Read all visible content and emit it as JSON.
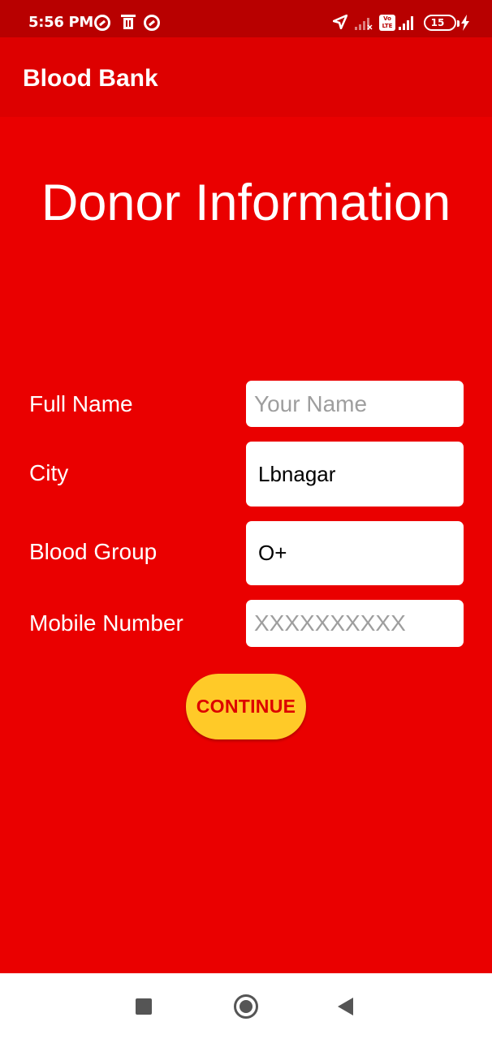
{
  "status_bar": {
    "time": "5:56 PM",
    "left_icons": [
      "sync-icon",
      "trash-icon",
      "sync-icon"
    ],
    "right_icons": [
      "navigation-icon",
      "signal-weak-icon",
      "volte-icon",
      "signal-icon",
      "battery-icon",
      "charging-icon"
    ],
    "volte_label": "Vo LTE",
    "battery_level": "15"
  },
  "app_bar": {
    "title": "Blood Bank"
  },
  "page": {
    "title": "Donor Information"
  },
  "form": {
    "full_name": {
      "label": "Full Name",
      "value": "",
      "placeholder": "Your Name"
    },
    "city": {
      "label": "City",
      "value": "Lbnagar",
      "placeholder": ""
    },
    "blood_group": {
      "label": "Blood Group",
      "value": "O+",
      "placeholder": ""
    },
    "mobile_number": {
      "label": "Mobile Number",
      "value": "",
      "placeholder": "XXXXXXXXXX"
    }
  },
  "continue_button": {
    "label": "CONTINUE"
  },
  "navigation_bar": {
    "buttons": [
      "recents-square-icon",
      "home-circle-icon",
      "back-triangle-icon"
    ]
  },
  "colors": {
    "background": "#EA0000",
    "app_bar": "#DD0000",
    "status_bar": "#B80000",
    "button": "#FFCA28",
    "button_text": "#DD0000",
    "input_background": "#FFFFFF"
  }
}
